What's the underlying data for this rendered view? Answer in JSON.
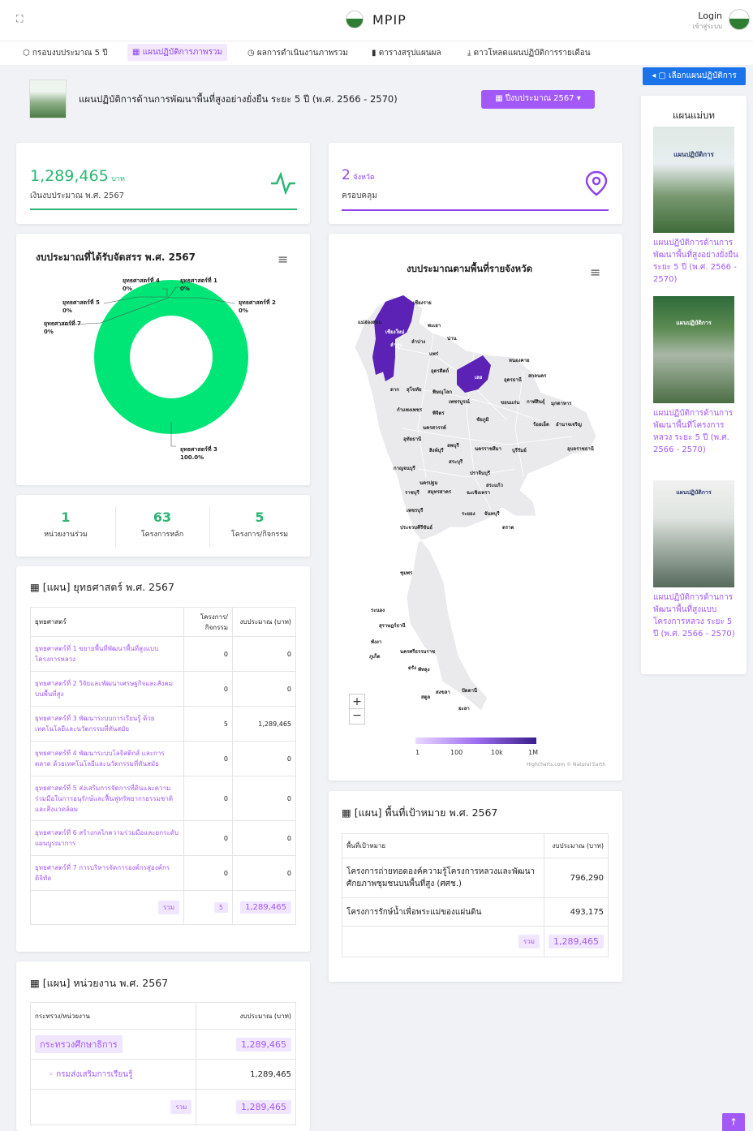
{
  "header": {
    "brand": "MPIP",
    "login": "Login",
    "login_sub": "เข้าสู่ระบบ"
  },
  "tabs": [
    {
      "icon": "⬡",
      "label": "กรอบงบประมาณ 5 ปี"
    },
    {
      "icon": "▦",
      "label": "แผนปฏิบัติการภาพรวม"
    },
    {
      "icon": "◷",
      "label": "ผลการดำเนินงานภาพรวม"
    },
    {
      "icon": "▮",
      "label": "ตารางสรุปแผนผล"
    },
    {
      "icon": "⤓",
      "label": "ดาวโหลดแผนปฏิบัติการรายเดือน"
    }
  ],
  "select_plan_button": "◂ ▢ เลือกแผนปฏิบัติการ",
  "plan": {
    "title": "แผนปฏิบัติการด้านการพัฒนาพื้นที่สูงอย่างยั่งยืน ระยะ 5 ปี (พ.ศ. 2566 - 2570)",
    "year_button": "▦ ปีงบประมาณ 2567 ▾"
  },
  "budget_card": {
    "value": "1,289,465",
    "unit": "บาท",
    "label": "เงินงบประมาณ พ.ศ. 2567",
    "color": "#2bb673"
  },
  "province_card": {
    "value": "2",
    "unit": "จังหวัด",
    "label": "ครอบคลุม",
    "color": "#8e44ec"
  },
  "donut": {
    "title": "งบประมาณที่ได้รับจัดสรร พ.ศ. 2567",
    "labels": [
      {
        "name": "ยุทธศาสตร์ที่ 4",
        "pct": "0%"
      },
      {
        "name": "ยุทธศาสตร์ที่ 1",
        "pct": "0%"
      },
      {
        "name": "ยุทธศาสตร์ที่ 5",
        "pct": "0%"
      },
      {
        "name": "ยุทธศาสตร์ที่ 2",
        "pct": "0%"
      },
      {
        "name": "ยุทธศาสตร์ที่ 7",
        "pct": "0%"
      },
      {
        "name": "ยุทธศาสตร์ที่ 3",
        "pct": "100.0%"
      }
    ],
    "color": "#00e676"
  },
  "counts": [
    {
      "value": "1",
      "label": "หน่วยงานร่วม"
    },
    {
      "value": "63",
      "label": "โครงการหลัก"
    },
    {
      "value": "5",
      "label": "โครงการ/กิจกรรม"
    }
  ],
  "strategy": {
    "title": "▦ [แผน] ยุทธศาสตร์ พ.ศ. 2567",
    "headers": [
      "ยุทธศาสตร์",
      "โครงการ/ กิจกรรม",
      "งบประมาณ (บาท)"
    ],
    "rows": [
      {
        "name": "ยุทธศาสตร์ที่ 1 ขยายพื้นที่พัฒนาพื้นที่สูงแบบโครงการหลวง",
        "count": "0",
        "budget": "0"
      },
      {
        "name": "ยุทธศาสตร์ที่ 2 วิจัยและพัฒนาเศรษฐกิจและสังคมบนพื้นที่สูง",
        "count": "0",
        "budget": "0"
      },
      {
        "name": "ยุทธศาสตร์ที่ 3 พัฒนาระบบการเรียนรู้ ด้วยเทคโนโลยีและนวัตกรรมที่ทันสมัย",
        "count": "5",
        "budget": "1,289,465"
      },
      {
        "name": "ยุทธศาสตร์ที่ 4 พัฒนาระบบโลจิสติกส์ และการตลาด ด้วยเทคโนโลยีและนวัตกรรมที่ทันสมัย",
        "count": "0",
        "budget": "0"
      },
      {
        "name": "ยุทธศาสตร์ที่ 5 ส่งเสริมการจัดการที่ดินและความร่วมมือในการอนุรักษ์และฟื้นฟูทรัพยากรธรรมชาติและสิ่งแวดล้อม",
        "count": "0",
        "budget": "0"
      },
      {
        "name": "ยุทธศาสตร์ที่ 6 สร้างกลไกความร่วมมือและยกระดับแผนบูรณาการ",
        "count": "0",
        "budget": "0"
      },
      {
        "name": "ยุทธศาสตร์ที่ 7 การบริหารจัดการองค์กรสู่องค์กรดิจิทัล",
        "count": "0",
        "budget": "0"
      }
    ],
    "total_label": "รวม",
    "total_count": "5",
    "total_budget": "1,289,465"
  },
  "agency": {
    "title": "▦ [แผน] หน่วยงาน พ.ศ. 2567",
    "headers": [
      "กระทรวง/หน่วยงาน",
      "งบประมาณ (บาท)"
    ],
    "ministry": "กระทรวงศึกษาธิการ",
    "ministry_budget": "1,289,465",
    "dept": "◦ กรมส่งเสริมการเรียนรู้",
    "dept_budget": "1,289,465",
    "total_label": "รวม",
    "total_budget": "1,289,465"
  },
  "map": {
    "title": "งบประมาณตามพื้นที่รายจังหวัด",
    "legend": [
      "1",
      "100",
      "10k",
      "1M"
    ],
    "credit": "Highcharts.com © Natural Earth",
    "province_labels": [
      "เชียงราย",
      "แม่ฮ่องสอน",
      "เชียงใหม่",
      "พะเยา",
      "น่าน",
      "ลำปาง",
      "ลำพูน",
      "แพร่",
      "หนองคาย",
      "สกลนคร",
      "อุดรธานี",
      "เลย",
      "อุตรดิตถ์",
      "ตาก",
      "สุโขทัย",
      "พิษณุโลก",
      "ขอนแก่น",
      "กาฬสินธุ์",
      "มุกดาหาร",
      "เพชรบูรณ์",
      "กำแพงเพชร",
      "พิจิตร",
      "ชัยภูมิ",
      "ร้อยเอ็ด",
      "อำนาจเจริญ",
      "นครสวรรค์",
      "อุทัยธานี",
      "ลพบุรี",
      "สิงห์บุรี",
      "นครราชสีมา",
      "บุรีรัมย์",
      "อุบลราชธานี",
      "สระบุรี",
      "กาญจนบุรี",
      "ปราจีนบุรี",
      "นครปฐม",
      "สระแก้ว",
      "ราชบุรี",
      "สมุทรสาคร",
      "ฉะเชิงเทรา",
      "เพชรบุรี",
      "ระยอง",
      "จันทบุรี",
      "ประจวบคีรีขันธ์",
      "ตราด",
      "ชุมพร",
      "ระนอง",
      "สุราษฎร์ธานี",
      "พังงา",
      "ภูเก็ต",
      "นครศรีธรรมราช",
      "ตรัง",
      "พัทลุง",
      "สงขลา",
      "ปัตตานี",
      "สตูล",
      "ยะลา"
    ]
  },
  "target": {
    "title": "▦ [แผน] พื้นที่เป้าหมาย พ.ศ. 2567",
    "headers": [
      "พื้นที่เป้าหมาย",
      "งบประมาณ (บาท)"
    ],
    "rows": [
      {
        "name": "โครงการถ่ายทอดองค์ความรู้โครงการหลวงและพัฒนาศักยภาพชุมชนบนพื้นที่สูง (ศศช.)",
        "budget": "796,290"
      },
      {
        "name": "โครงการรักษ์น้ำเพื่อพระแม่ของแผ่นดิน",
        "budget": "493,175"
      }
    ],
    "total_label": "รวม",
    "total_budget": "1,289,465"
  },
  "sidebar": {
    "title": "แผนแม่บท",
    "items": [
      {
        "label": "แผนปฏิบัติการด้านการพัฒนาพื้นที่สูงอย่างยั่งยืน ระยะ 5 ปี (พ.ศ. 2566 - 2570)"
      },
      {
        "label": "แผนปฏิบัติการด้านการพัฒนาพื้นที่โครงการหลวง ระยะ 5 ปี (พ.ศ. 2566 - 2570)"
      },
      {
        "label": "แผนปฏิบัติการด้านการพัฒนาพื้นที่สูงแบบโครงการหลวง ระยะ 5 ปี (พ.ศ. 2566 - 2570)"
      }
    ],
    "cover_titles": [
      "แผนปฏิบัติการ",
      "แผนปฏิบัติการ",
      "แผนปฏิบัติการ"
    ]
  }
}
